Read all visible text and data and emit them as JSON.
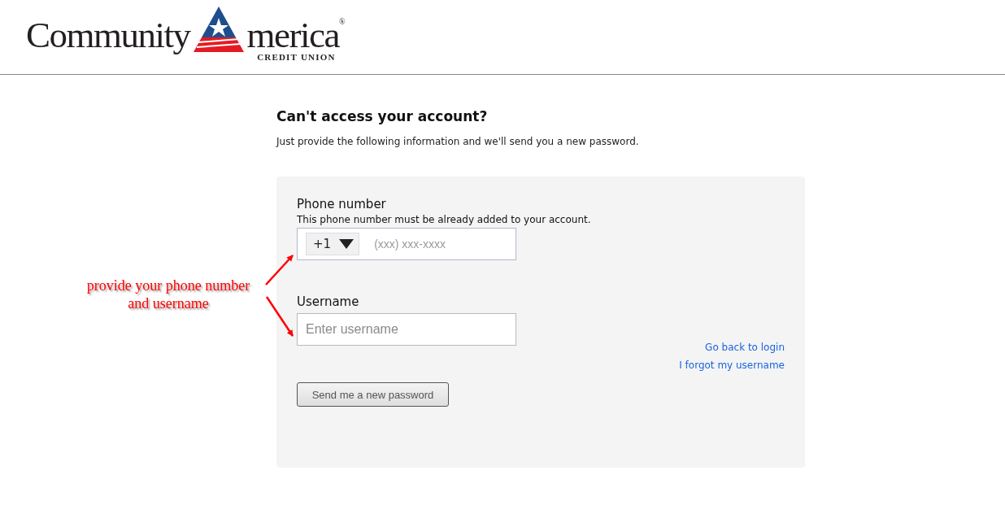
{
  "logo": {
    "name_start": "Community",
    "name_end": "merica",
    "registered": "®",
    "tagline": "CREDIT UNION"
  },
  "heading": "Can't access your account?",
  "intro": "Just provide the following information and we'll send you a new password.",
  "form": {
    "phone": {
      "label": "Phone number",
      "hint": "This phone number must be already added to your account.",
      "country_code": "+1",
      "placeholder": "(xxx) xxx-xxxx"
    },
    "username": {
      "label": "Username",
      "placeholder": "Enter username"
    },
    "links": [
      "Go back to login",
      "I forgot my username"
    ],
    "submit": "Send me a new password"
  },
  "annotation": {
    "text": "provide your phone number and username"
  }
}
